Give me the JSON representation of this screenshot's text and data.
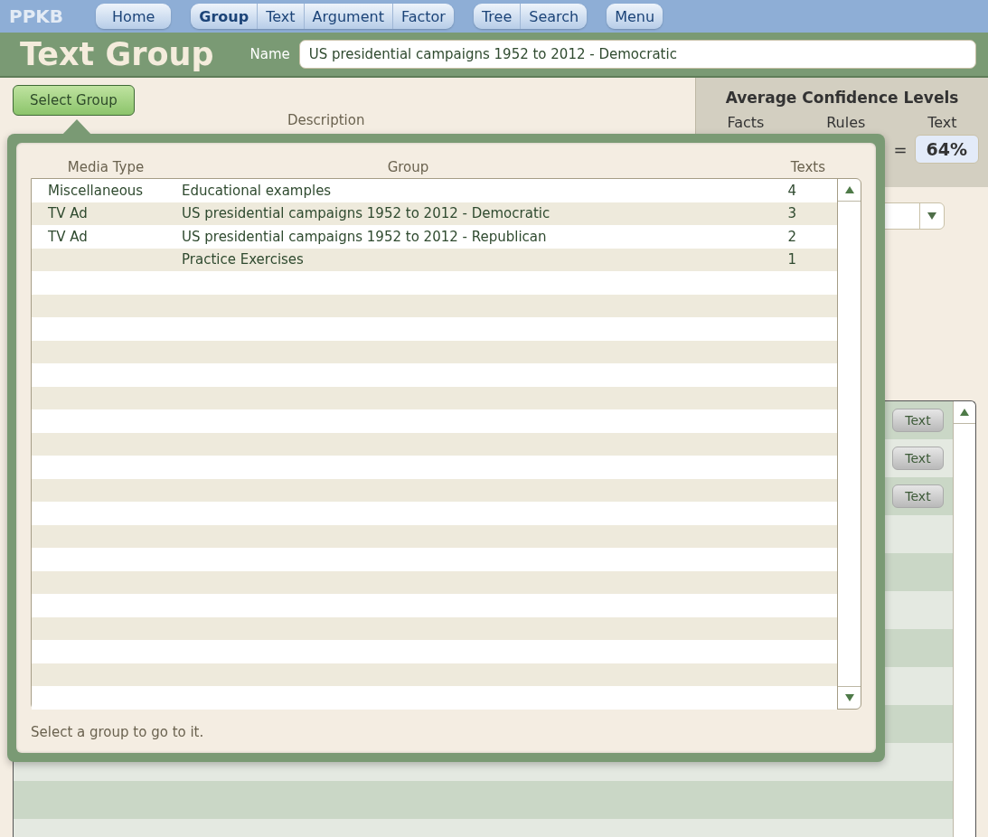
{
  "nav": {
    "logo": "PPKB",
    "groups": [
      [
        {
          "label": "Home",
          "selected": false
        }
      ],
      [
        {
          "label": "Group",
          "selected": true
        },
        {
          "label": "Text",
          "selected": false
        },
        {
          "label": "Argument",
          "selected": false
        },
        {
          "label": "Factor",
          "selected": false
        }
      ],
      [
        {
          "label": "Tree",
          "selected": false
        },
        {
          "label": "Search",
          "selected": false
        }
      ],
      [
        {
          "label": "Menu",
          "selected": false
        }
      ]
    ]
  },
  "header": {
    "title": "Text Group",
    "name_label": "Name",
    "name_value": "US presidential campaigns 1952 to 2012 - Democratic"
  },
  "select_group_button": "Select Group",
  "description_label": "Description",
  "confidence": {
    "title": "Average Confidence Levels",
    "columns": [
      "Facts",
      "Rules",
      "Text"
    ],
    "equals": "=",
    "text_value": "64%"
  },
  "texts_list": {
    "buttons": [
      "Text",
      "Text",
      "Text"
    ]
  },
  "group_picker": {
    "columns": [
      "Media Type",
      "Group",
      "Texts"
    ],
    "rows": [
      {
        "media_type": "Miscellaneous",
        "group": "Educational examples",
        "texts": "4"
      },
      {
        "media_type": "TV Ad",
        "group": "US presidential campaigns 1952 to 2012 - Democratic",
        "texts": "3"
      },
      {
        "media_type": "TV Ad",
        "group": "US presidential campaigns 1952 to 2012 - Republican",
        "texts": "2"
      },
      {
        "media_type": "",
        "group": "Practice Exercises",
        "texts": "1"
      }
    ],
    "hint": "Select a group to go to it."
  }
}
